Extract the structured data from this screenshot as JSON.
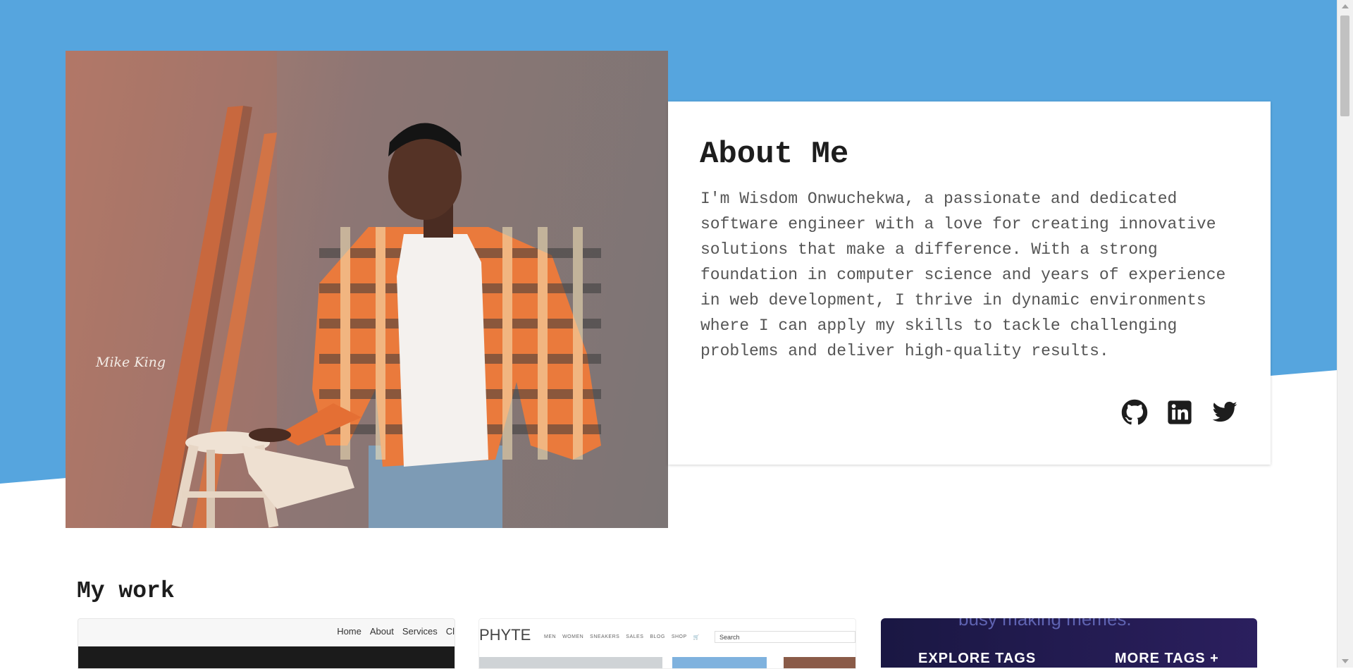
{
  "about": {
    "title": "About Me",
    "text": "I'm Wisdom Onwuchekwa, a passionate and dedicated software engineer with a love for creating innovative solutions that make a difference. With a strong foundation in computer science and years of experience in web development, I thrive in dynamic environments where I can apply my skills to tackle challenging problems and deliver high-quality results.",
    "socials": [
      {
        "icon": "github-icon"
      },
      {
        "icon": "linkedin-icon"
      },
      {
        "icon": "twitter-icon"
      }
    ]
  },
  "photo": {
    "watermark": "Mike King"
  },
  "work": {
    "title": "My work",
    "card1": {
      "nav": [
        "Home",
        "About",
        "Services",
        "Cl"
      ]
    },
    "card2": {
      "brand": "PHYTE",
      "menu": [
        "MEN",
        "WOMEN",
        "SNEAKERS",
        "SALES",
        "BLOG",
        "SHOP"
      ],
      "cart_icon": "cart-icon",
      "search_placeholder": "Search"
    },
    "card3": {
      "faded_heading": "busy making memes.",
      "explore": "EXPLORE TAGS",
      "more": "MORE TAGS +"
    }
  },
  "colors": {
    "hero": "#56a5de",
    "card3": "#1a1743"
  }
}
